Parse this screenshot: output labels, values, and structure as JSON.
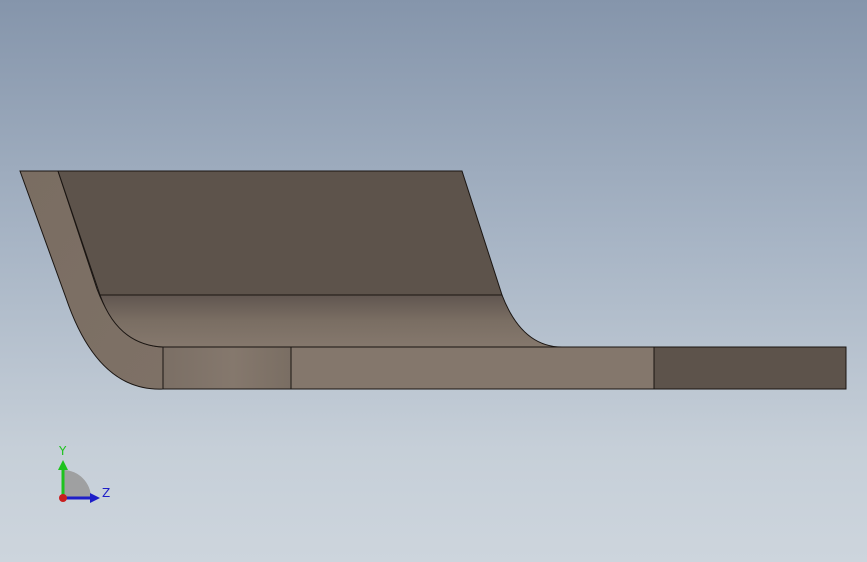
{
  "viewport": {
    "background_top": "#8595ab",
    "background_bottom": "#cdd5dd"
  },
  "model": {
    "name": "bent-sheet-metal-bracket",
    "colors": {
      "dark_face": "#5d534b",
      "light_face": "#84776c",
      "edge": "#1a1512"
    }
  },
  "triad": {
    "y_label": "Y",
    "z_label": "Z",
    "y_color": "#1ec21e",
    "z_color": "#1e1ec8",
    "x_color": "#c81e1e"
  }
}
